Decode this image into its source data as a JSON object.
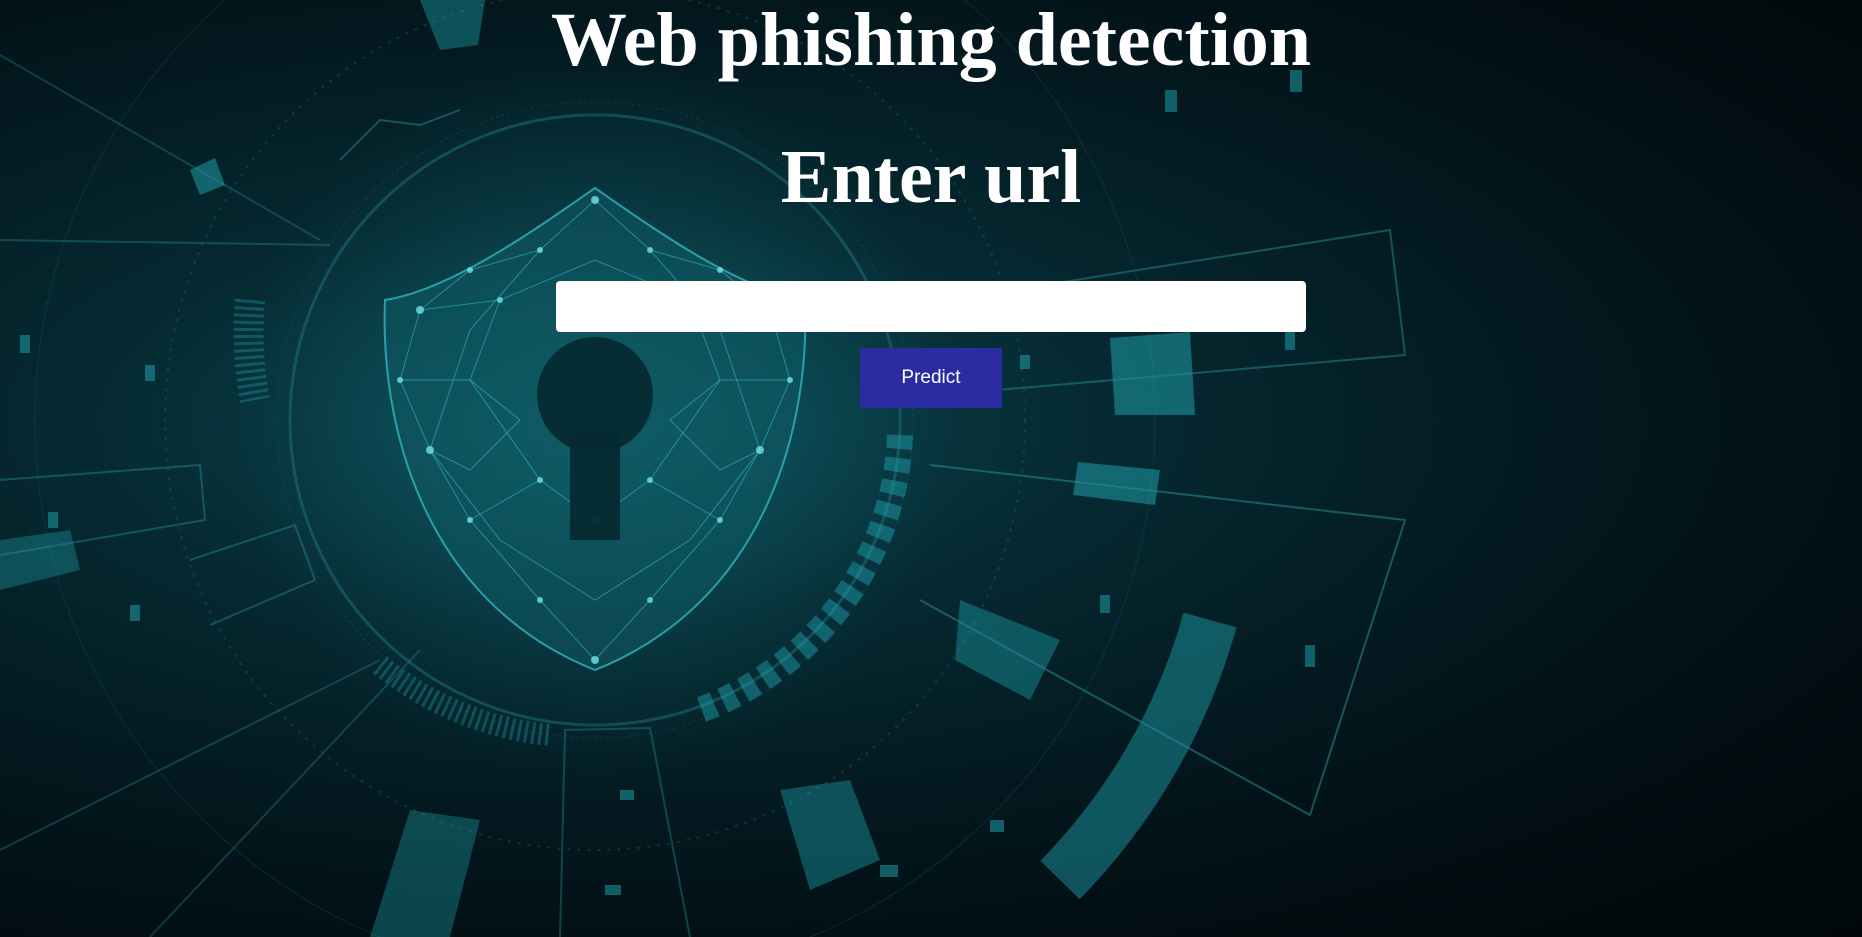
{
  "page": {
    "title": "Web phishing detection",
    "subtitle": "Enter url"
  },
  "form": {
    "url_value": "",
    "url_placeholder": "",
    "predict_label": "Predict"
  },
  "colors": {
    "background": "#031a20",
    "accent_teal": "#1fa7b3",
    "button": "#2b2ca2",
    "text": "#ffffff"
  },
  "background_art": {
    "icon": "shield-keyhole-icon"
  }
}
